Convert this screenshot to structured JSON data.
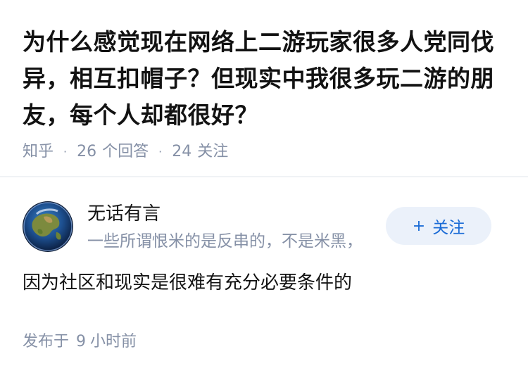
{
  "question": {
    "title": "为什么感觉现在网络上二游玩家很多人党同伐异，相互扣帽子？但现实中我很多玩二游的朋友，每个人却都很好？",
    "source": "知乎",
    "answer_count": "26",
    "answer_label": "个回答",
    "follower_count": "24",
    "follower_label": "关注"
  },
  "answer": {
    "author": {
      "name": "无话有言",
      "bio": "一些所谓恨米的是反串的，不是米黑，",
      "avatar_icon": "earth-globe-avatar"
    },
    "follow_button_label": "关注",
    "content": "因为社区和现实是很难有充分必要条件的",
    "time_prefix": "发布于",
    "time_value": "9",
    "time_suffix": "小时前"
  },
  "colors": {
    "meta_gray": "#8590a6",
    "accent_blue": "#1a6bd6",
    "follow_bg": "#ebf1fa",
    "text": "#121212"
  }
}
